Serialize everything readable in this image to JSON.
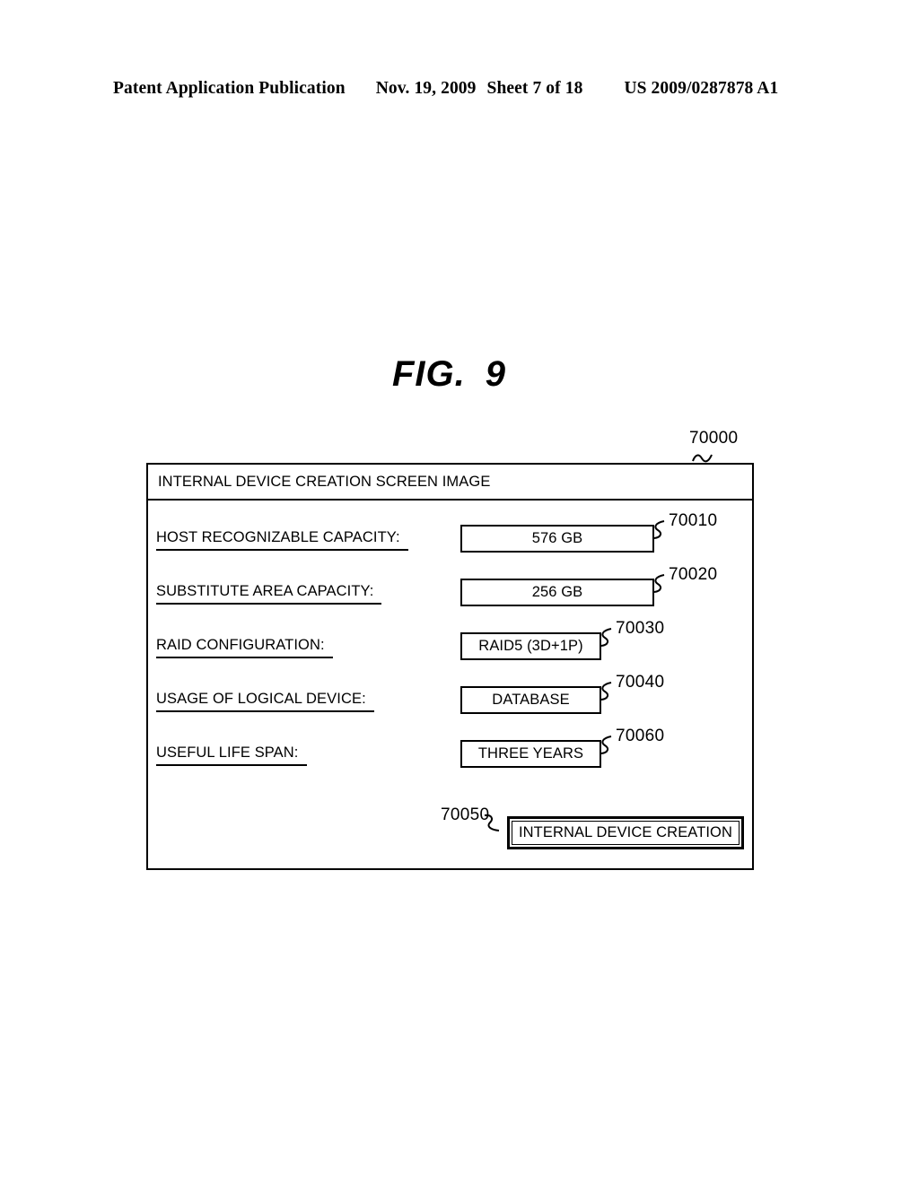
{
  "header": {
    "publication": "Patent Application Publication",
    "date": "Nov. 19, 2009",
    "sheet": "Sheet 7 of 18",
    "patent_number": "US 2009/0287878 A1"
  },
  "figure": {
    "label": "FIG.",
    "number": "9"
  },
  "screen": {
    "ref": "70000",
    "title": "INTERNAL DEVICE CREATION SCREEN IMAGE",
    "rows": [
      {
        "label": "HOST RECOGNIZABLE CAPACITY:",
        "value": "576 GB",
        "ref": "70010",
        "box_width": "wide"
      },
      {
        "label": "SUBSTITUTE AREA CAPACITY:",
        "value": "256 GB",
        "ref": "70020",
        "box_width": "wide"
      },
      {
        "label": "RAID CONFIGURATION:",
        "value": "RAID5 (3D+1P)",
        "ref": "70030",
        "box_width": "narrow"
      },
      {
        "label": "USAGE OF LOGICAL DEVICE:",
        "value": "DATABASE",
        "ref": "70040",
        "box_width": "narrow"
      },
      {
        "label": "USEFUL LIFE SPAN:",
        "value": "THREE YEARS",
        "ref": "70060",
        "box_width": "narrow"
      }
    ],
    "button": {
      "label": "INTERNAL DEVICE CREATION",
      "ref": "70050"
    }
  },
  "colors": {
    "ink": "#000000",
    "paper": "#ffffff"
  }
}
